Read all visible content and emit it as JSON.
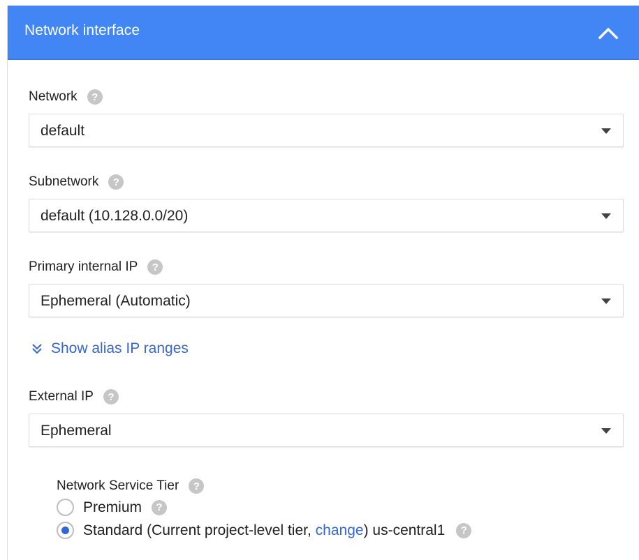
{
  "header": {
    "title": "Network interface",
    "collapse_icon": "chevron-up-icon",
    "color": "#4285f4"
  },
  "fields": {
    "network": {
      "label": "Network",
      "value": "default"
    },
    "subnetwork": {
      "label": "Subnetwork",
      "value": "default (10.128.0.0/20)"
    },
    "primary_internal_ip": {
      "label": "Primary internal IP",
      "value": "Ephemeral (Automatic)"
    },
    "external_ip": {
      "label": "External IP",
      "value": "Ephemeral"
    }
  },
  "alias": {
    "label": "Show alias IP ranges",
    "icon": "double-chevron-down-icon",
    "color": "#3367d6"
  },
  "network_service_tier": {
    "title": "Network Service Tier",
    "options": [
      {
        "label": "Premium",
        "selected": false
      },
      {
        "label_prefix": "Standard (Current project-level tier, ",
        "link": "change",
        "label_suffix": ") us-central1",
        "selected": true
      }
    ]
  },
  "help_icon": "?"
}
